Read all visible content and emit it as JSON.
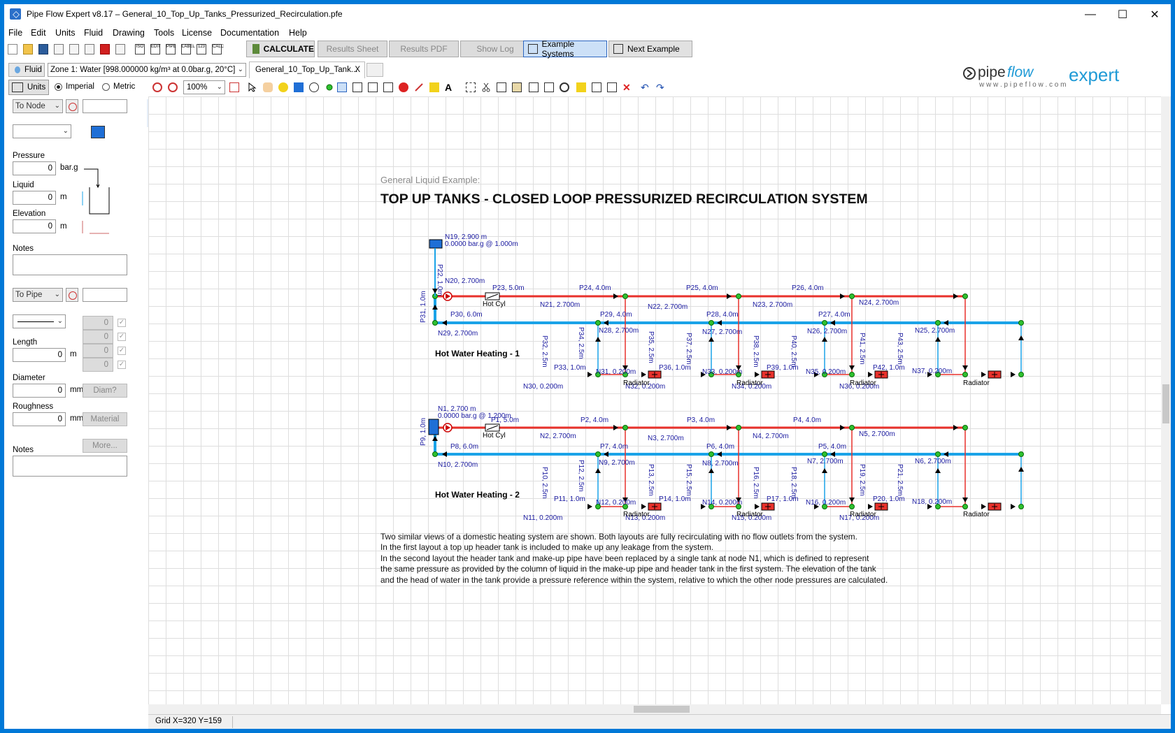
{
  "window": {
    "title": "Pipe Flow Expert v8.17 – General_10_Top_Up_Tanks_Pressurized_Recirculation.pfe"
  },
  "menu": [
    "File",
    "Edit",
    "Units",
    "Fluid",
    "Drawing",
    "Tools",
    "License",
    "Documentation",
    "Help"
  ],
  "toolbar": {
    "calc_labels": [
      "ISO",
      "EDIT",
      "PIPE",
      "LABEL",
      "123",
      "CALC"
    ],
    "calculate": "CALCULATE",
    "results_sheet": "Results Sheet",
    "results_pdf": "Results PDF",
    "show_log": "Show Log",
    "example_systems": "Example Systems",
    "next_example": "Next Example"
  },
  "fluid_row": {
    "fluid_button": "Fluid",
    "fluid_zone": "Zone 1: Water [998.000000 kg/m³ at 0.0bar.g, 20°C]",
    "doc_tab": "General_10_Top_Up_Tank...",
    "tab_close": "X"
  },
  "units_row": {
    "units_button": "Units",
    "imperial": "Imperial",
    "metric": "Metric",
    "zoom": "100%"
  },
  "logo": {
    "text1": "pipe",
    "text2": "flow",
    "text3": "expert",
    "url": "w w w . p i p e f l o w . c o m"
  },
  "left_panel": {
    "node_select": "To Node",
    "pressure_label": "Pressure",
    "pressure_value": "0",
    "pressure_unit": "bar.g",
    "liquid_label": "Liquid",
    "liquid_value": "0",
    "liquid_unit": "m",
    "elevation_label": "Elevation",
    "elevation_value": "0",
    "elevation_unit": "m",
    "notes_label": "Notes",
    "pipe_select": "To Pipe",
    "fitting_counts": [
      "0",
      "0",
      "0",
      "0"
    ],
    "length_label": "Length",
    "length_value": "0",
    "length_unit": "m",
    "diameter_label": "Diameter",
    "diameter_value": "0",
    "diameter_unit": "mm",
    "diam_button": "Diam?",
    "roughness_label": "Roughness",
    "roughness_value": "0",
    "roughness_unit": "mm",
    "material_button": "Material",
    "more_button": "More...",
    "notes2_label": "Notes"
  },
  "canvas": {
    "subtitle": "General Liquid Example:",
    "title": "TOP UP TANKS - CLOSED LOOP PRESSURIZED RECIRCULATION SYSTEM",
    "system1_label": "Hot Water Heating - 1",
    "system2_label": "Hot Water Heating - 2",
    "description": [
      "Two similar views of a domestic heating system are shown. Both layouts are fully recirculating with no flow outlets from the system.",
      "In the first layout a top up header tank is included to make up any leakage from the system.",
      "In the second layout the header tank and make-up pipe have been replaced by a single tank at node N1, which is defined to represent",
      "the same pressure as provided by the column of liquid in the make-up pipe and header tank in the first system. The elevation of the tank",
      "and the head of water in the tank provide a pressure reference within the system, relative to which the other node pressures are calculated."
    ],
    "labels1": [
      "N19, 2.900 m",
      "0.0000 bar.g @ 1.000m",
      "P22, 1.0m",
      "N20, 2.700m",
      "P23, 5.0m",
      "P24, 4.0m",
      "P25, 4.0m",
      "P26, 4.0m",
      "Hot Cyl",
      "N21, 2.700m",
      "N22, 2.700m",
      "N23, 2.700m",
      "N24, 2.700m",
      "P31, 1.0m",
      "P30, 6.0m",
      "P29, 4.0m",
      "P28, 4.0m",
      "P27, 4.0m",
      "N29, 2.700m",
      "N28, 2.700m",
      "N27, 2.700m",
      "N26, 2.700m",
      "N25, 2.700m",
      "P32, 2.5m",
      "P34, 2.5m",
      "P35, 2.5m",
      "P37, 2.5m",
      "P38, 2.5m",
      "P40, 2.5m",
      "P41, 2.5m",
      "P43, 2.5m",
      "P33, 1.0m",
      "P36, 1.0m",
      "P39, 1.0m",
      "P42, 1.0m",
      "N31, 0.200m",
      "N33, 0.200m",
      "N35, 0.200m",
      "N37, 0.200m",
      "N30, 0.200m",
      "N32, 0.200m",
      "N34, 0.200m",
      "N36, 0.200m",
      "Radiator"
    ],
    "labels2": [
      "N1, 2.700 m",
      "0.0000 bar.g @ 1.200m",
      "P1, 5.0m",
      "P2, 4.0m",
      "P3, 4.0m",
      "P4, 4.0m",
      "P9, 1.0m",
      "P8, 6.0m",
      "P7, 4.0m",
      "P6, 4.0m",
      "P5, 4.0m",
      "N2, 2.700m",
      "N3, 2.700m",
      "N4, 2.700m",
      "N5, 2.700m",
      "N10, 2.700m",
      "N9, 2.700m",
      "N8, 2.700m",
      "N7, 2.700m",
      "N6, 2.700m",
      "P10, 2.5m",
      "P12, 2.5m",
      "P13, 2.5m",
      "P15, 2.5m",
      "P16, 2.5m",
      "P18, 2.5m",
      "P19, 2.5m",
      "P21, 2.5m",
      "P11, 1.0m",
      "P14, 1.0m",
      "P17, 1.0m",
      "P20, 1.0m",
      "N12, 0.200m",
      "N14, 0.200m",
      "N16, 0.200m",
      "N18, 0.200m",
      "N11, 0.200m",
      "N13, 0.200m",
      "N15, 0.200m",
      "N17, 0.200m"
    ]
  },
  "statusbar": {
    "grid": "Grid  X=320  Y=159"
  },
  "colors": {
    "hot": "#e8312b",
    "cold": "#1aa3e8",
    "node": "#2fc12f",
    "text_blue": "#1a1aa0",
    "accent": "#0078d7"
  }
}
